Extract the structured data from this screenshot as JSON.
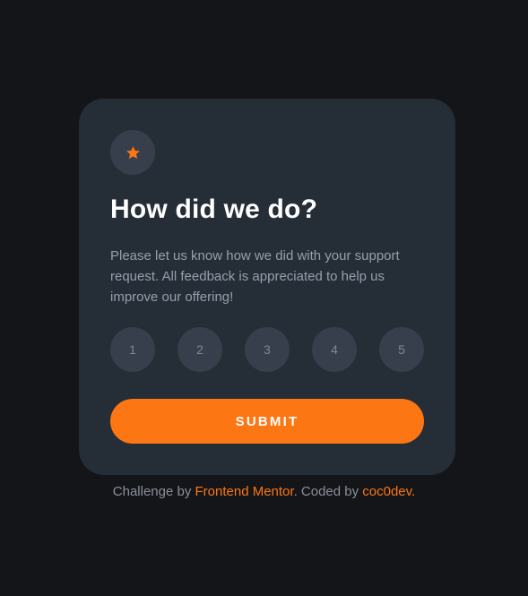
{
  "card": {
    "title": "How did we do?",
    "description": "Please let us know how we did with your support request. All feedback is appreciated to help us improve our offering!",
    "icon": "star-icon",
    "ratings": [
      "1",
      "2",
      "3",
      "4",
      "5"
    ],
    "submit_label": "SUBMIT"
  },
  "attribution": {
    "prefix": "Challenge by ",
    "link1": "Frontend Mentor",
    "middle": ". Coded by ",
    "link2": "coc0dev",
    "suffix": "."
  },
  "colors": {
    "background": "#141519",
    "card": "#252d37",
    "accent": "#fc7614",
    "circle": "#363f4b",
    "text_muted": "#969fad"
  }
}
